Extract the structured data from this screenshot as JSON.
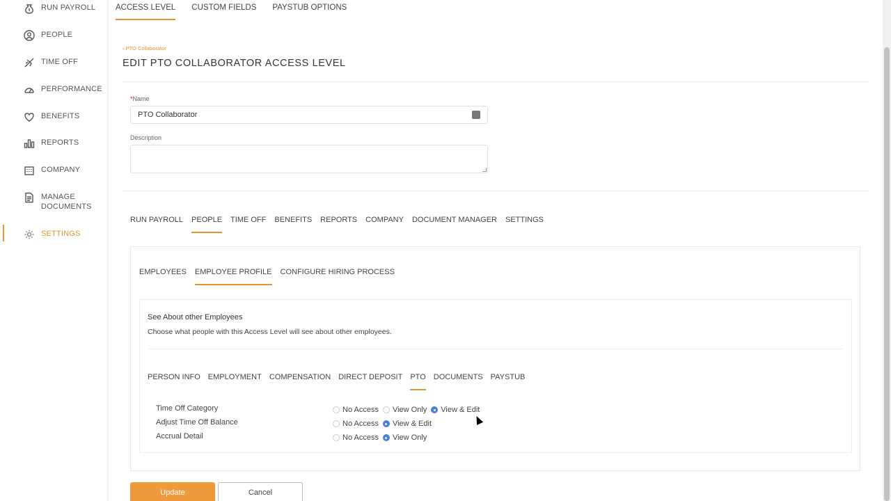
{
  "sidebar": {
    "items": [
      {
        "label": "RUN PAYROLL",
        "icon": "money-bag-icon"
      },
      {
        "label": "PEOPLE",
        "icon": "person-icon"
      },
      {
        "label": "TIME OFF",
        "icon": "airplane-icon"
      },
      {
        "label": "PERFORMANCE",
        "icon": "gauge-icon"
      },
      {
        "label": "BENEFITS",
        "icon": "heart-shield-icon"
      },
      {
        "label": "REPORTS",
        "icon": "bar-chart-icon"
      },
      {
        "label": "COMPANY",
        "icon": "building-icon"
      },
      {
        "label": "MANAGE\nDOCUMENTS",
        "icon": "document-icon"
      },
      {
        "label": "SETTINGS",
        "icon": "gear-icon"
      }
    ],
    "active": "SETTINGS"
  },
  "top_tabs": [
    "ACCESS LEVEL",
    "CUSTOM FIELDS",
    "PAYSTUB OPTIONS"
  ],
  "breadcrumb": "‹ PTO Collaborator",
  "page_title": "EDIT PTO COLLABORATOR ACCESS LEVEL",
  "form": {
    "name_label": "Name",
    "name_required_mark": "*",
    "name_value": "PTO Collaborator",
    "description_label": "Description",
    "description_value": ""
  },
  "section_tabs": [
    "RUN PAYROLL",
    "PEOPLE",
    "TIME OFF",
    "BENEFITS",
    "REPORTS",
    "COMPANY",
    "DOCUMENT MANAGER",
    "SETTINGS"
  ],
  "sub_tabs": [
    "EMPLOYEES",
    "EMPLOYEE PROFILE",
    "CONFIGURE HIRING PROCESS"
  ],
  "inner": {
    "title": "See About other Employees",
    "description": "Choose what people with this Access Level will see about other employees."
  },
  "perm_tabs": [
    "PERSON INFO",
    "EMPLOYMENT",
    "COMPENSATION",
    "DIRECT DEPOSIT",
    "PTO",
    "DOCUMENTS",
    "PAYSTUB"
  ],
  "permissions": [
    {
      "label": "Time Off Category",
      "options": [
        "No Access",
        "View Only",
        "View & Edit"
      ],
      "selected": "View & Edit"
    },
    {
      "label": "Adjust Time Off Balance",
      "options": [
        "No Access",
        "View & Edit"
      ],
      "selected": "View & Edit"
    },
    {
      "label": "Accrual Detail",
      "options": [
        "No Access",
        "View Only"
      ],
      "selected": "View Only"
    }
  ],
  "buttons": {
    "update": "Update",
    "cancel": "Cancel"
  },
  "colors": {
    "accent": "#e8922e",
    "radio_selected": "#4a7fd6"
  }
}
